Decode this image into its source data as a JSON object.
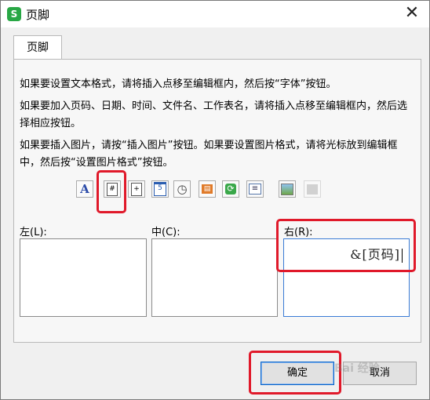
{
  "window": {
    "title": "页脚",
    "app_icon": "S",
    "close_glyph": "✕"
  },
  "tabs": [
    {
      "label": "页脚"
    }
  ],
  "instructions": [
    "如果要设置文本格式，请将插入点移至编辑框内，然后按“字体”按钮。",
    "如果要加入页码、日期、时间、文件名、工作表名，请将插入点移至编辑框内，然后选择相应按钮。",
    "如果要插入图片，请按“插入图片”按钮。如果要设置图片格式，请将光标放到编辑框中，然后按“设置图片格式”按钮。"
  ],
  "toolbar": [
    {
      "icon": "font-icon",
      "glyph": "A"
    },
    {
      "icon": "page-number-icon",
      "glyph": "#"
    },
    {
      "icon": "total-pages-icon",
      "glyph": "+"
    },
    {
      "icon": "date-icon",
      "glyph": "5"
    },
    {
      "icon": "time-icon",
      "glyph": "◷"
    },
    {
      "icon": "file-path-icon",
      "glyph": "▤"
    },
    {
      "icon": "filename-icon",
      "glyph": "⟳"
    },
    {
      "icon": "sheet-name-icon",
      "glyph": "≡"
    },
    {
      "icon": "insert-picture-icon",
      "glyph": "▣"
    },
    {
      "icon": "format-picture-icon",
      "glyph": "▦"
    }
  ],
  "sections": {
    "left": {
      "label": "左(L):",
      "value": ""
    },
    "center": {
      "label": "中(C):",
      "value": ""
    },
    "right": {
      "label": "右(R):",
      "value": "&[页码]"
    }
  },
  "buttons": {
    "ok": "确定",
    "cancel": "取消"
  },
  "watermark": "Bai 经验",
  "colors": {
    "highlight": "#e0192a",
    "focus": "#3a7bd5",
    "brand": "#28a745"
  }
}
